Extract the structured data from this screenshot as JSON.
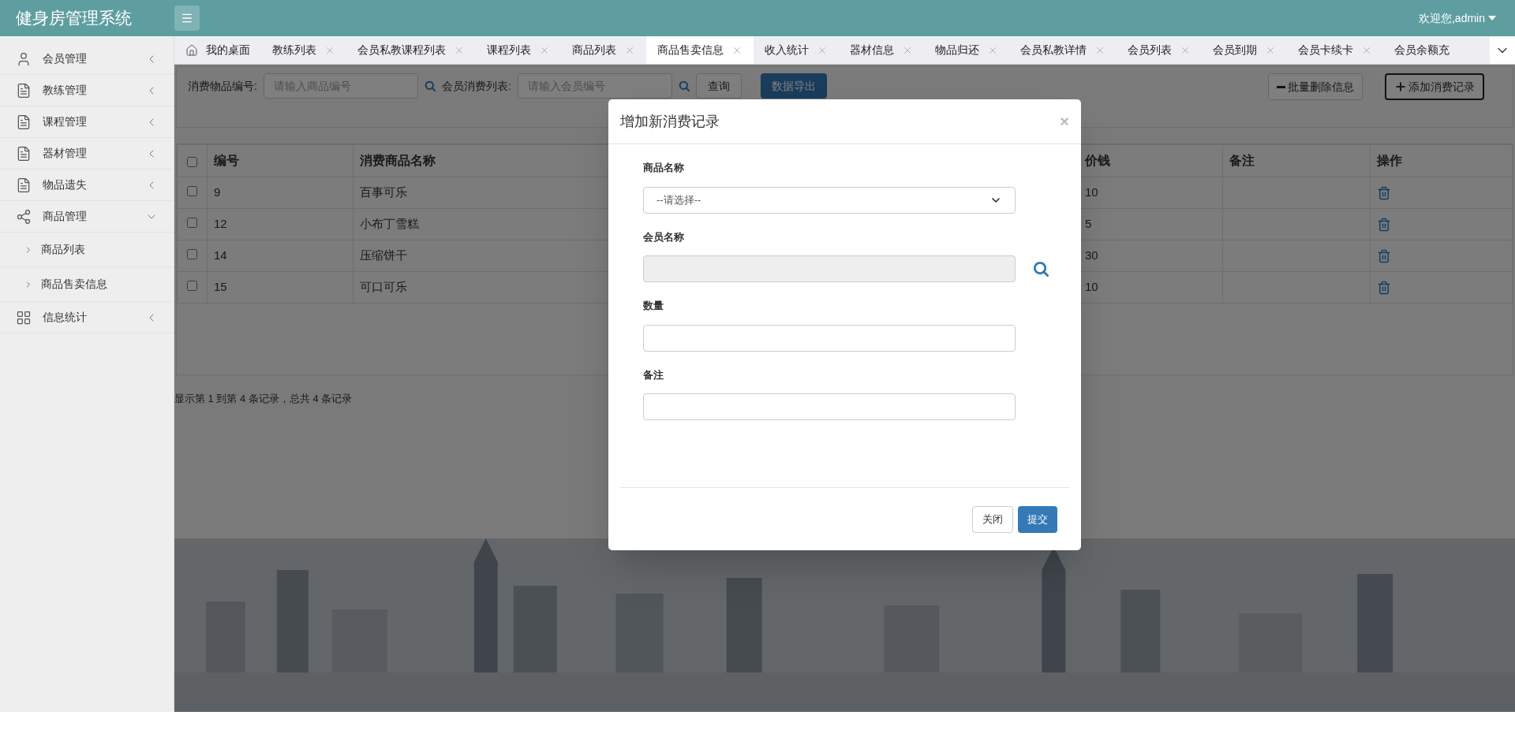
{
  "app_title": "健身房管理系统",
  "user_menu": "欢迎您,admin",
  "sidebar": [
    {
      "label": "会员管理",
      "expanded": false
    },
    {
      "label": "教练管理",
      "expanded": false
    },
    {
      "label": "课程管理",
      "expanded": false
    },
    {
      "label": "器材管理",
      "expanded": false
    },
    {
      "label": "物品遗失",
      "expanded": false
    },
    {
      "label": "商品管理",
      "expanded": true,
      "children": [
        {
          "label": "商品列表"
        },
        {
          "label": "商品售卖信息"
        }
      ]
    },
    {
      "label": "信息统计",
      "expanded": false
    }
  ],
  "tabs": [
    {
      "label": "我的桌面",
      "kind": "home",
      "selected": false
    },
    {
      "label": "教练列表",
      "kind": "closable",
      "selected": false
    },
    {
      "label": "会员私教课程列表",
      "kind": "closable",
      "selected": false
    },
    {
      "label": "课程列表",
      "kind": "closable",
      "selected": false
    },
    {
      "label": "商品列表",
      "kind": "closable",
      "selected": false
    },
    {
      "label": "商品售卖信息",
      "kind": "closable",
      "selected": true
    },
    {
      "label": "收入统计",
      "kind": "closable",
      "selected": false
    },
    {
      "label": "器材信息",
      "kind": "closable",
      "selected": false
    },
    {
      "label": "物品归还",
      "kind": "closable",
      "selected": false
    },
    {
      "label": "会员私教详情",
      "kind": "closable",
      "selected": false
    },
    {
      "label": "会员列表",
      "kind": "closable",
      "selected": false
    },
    {
      "label": "会员到期",
      "kind": "closable",
      "selected": false
    },
    {
      "label": "会员卡续卡",
      "kind": "closable",
      "selected": false
    },
    {
      "label": "会员余额充",
      "kind": "cut",
      "selected": false
    }
  ],
  "search": {
    "item_label": "消费物品编号:",
    "item_placeholder": "请输入商品编号",
    "member_label": "会员消费列表:",
    "member_placeholder": "请输入会员编号",
    "query_button": "查询",
    "export_button": "数据导出",
    "batch_delete_button": "批量删除信息",
    "add_button": "添加消费记录"
  },
  "table": {
    "columns": [
      "编号",
      "消费商品名称",
      "价钱",
      "备注",
      "操作"
    ],
    "rows": [
      {
        "checked": false,
        "id": "9",
        "name": "百事可乐",
        "price": "10"
      },
      {
        "checked": false,
        "id": "12",
        "name": "小布丁雪糕",
        "price": "5"
      },
      {
        "checked": false,
        "id": "14",
        "name": "压缩饼干",
        "price": "30"
      },
      {
        "checked": false,
        "id": "15",
        "name": "可口可乐",
        "price": "10"
      }
    ],
    "header_checked": false
  },
  "pagination_info": "显示第 1 到第 4 条记录，总共 4 条记录",
  "modal": {
    "title": "增加新消费记录",
    "close": "×",
    "fields": [
      {
        "label": "商品名称",
        "kind": "select",
        "value": "--请选择--"
      },
      {
        "label": "会员名称",
        "kind": "readonly_search"
      },
      {
        "label": "数量",
        "kind": "text"
      },
      {
        "label": "备注",
        "kind": "text"
      }
    ],
    "cancel_button": "关闭",
    "submit_button": "提交"
  }
}
